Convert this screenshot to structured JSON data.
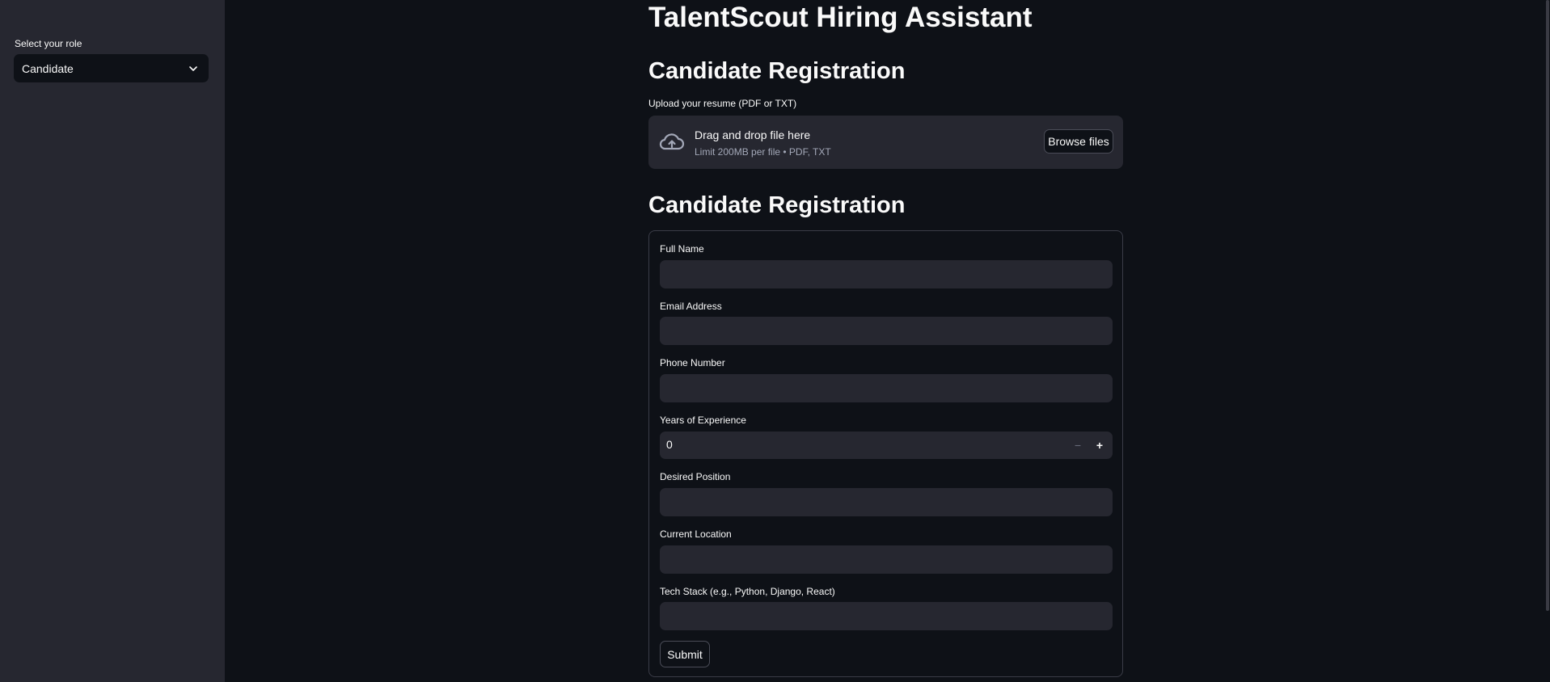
{
  "sidebar": {
    "role_label": "Select your role",
    "role_selected": "Candidate",
    "role_icon": "chevron-down-icon"
  },
  "main": {
    "title": "TalentScout Hiring Assistant",
    "upload_section_title": "Candidate Registration",
    "upload": {
      "label": "Upload your resume (PDF or TXT)",
      "drop_text": "Drag and drop file here",
      "limit_text": "Limit 200MB per file • PDF, TXT",
      "browse_label": "Browse files",
      "icon": "cloud-upload-icon"
    },
    "form_section_title": "Candidate Registration",
    "form": {
      "full_name_label": "Full Name",
      "full_name_value": "",
      "email_label": "Email Address",
      "email_value": "",
      "phone_label": "Phone Number",
      "phone_value": "",
      "experience_label": "Years of Experience",
      "experience_value": "0",
      "experience_decrement": "−",
      "experience_increment": "+",
      "position_label": "Desired Position",
      "position_value": "",
      "location_label": "Current Location",
      "location_value": "",
      "tech_stack_label": "Tech Stack (e.g., Python, Django, React)",
      "tech_stack_value": "",
      "submit_label": "Submit"
    }
  },
  "colors": {
    "background": "#0e1117",
    "sidebar": "#262730",
    "input": "#262730",
    "text": "#fafafa",
    "muted_text": "#a3a8b8"
  }
}
